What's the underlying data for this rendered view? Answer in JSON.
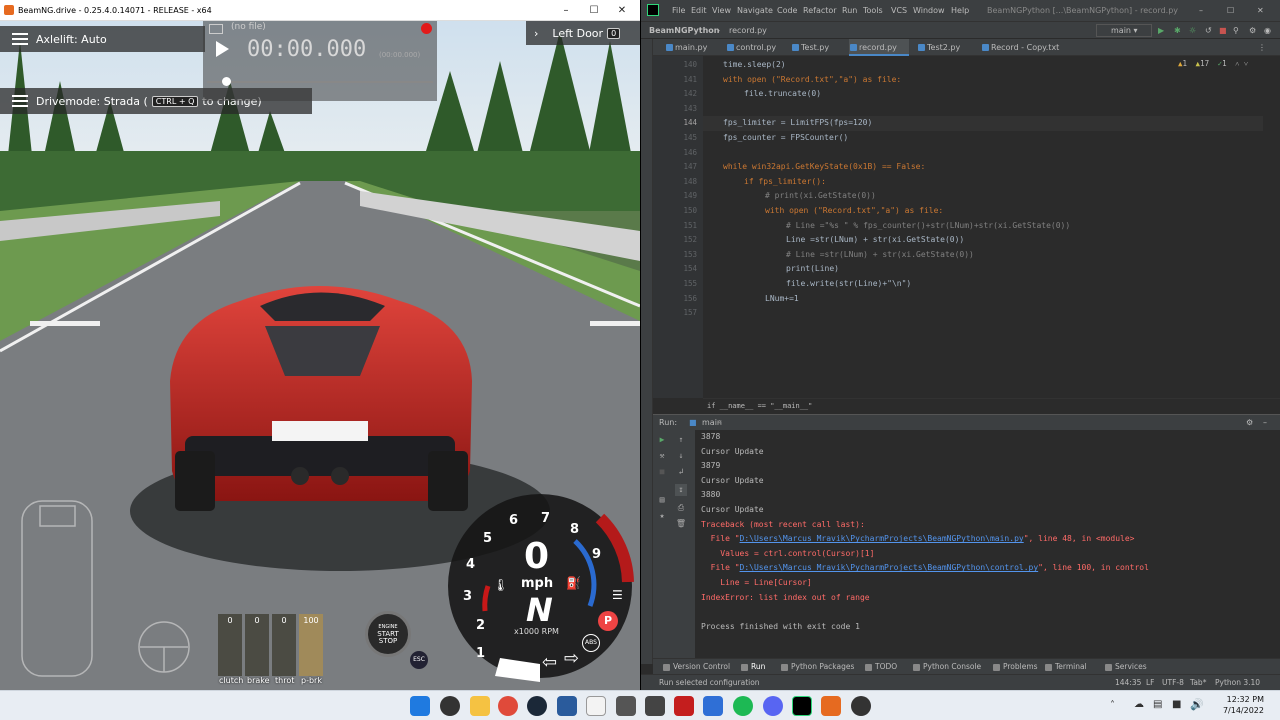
{
  "beamng": {
    "window_title": "BeamNG.drive - 0.25.4.0.14071 - RELEASE - x64",
    "hud": {
      "axlelift_label": "Axlelift: Auto",
      "drivemode_label": "Drivemode: Strada (",
      "drivemode_key": "CTRL + Q",
      "drivemode_suffix": "to change)",
      "file_label": "(no file)",
      "timer": "00:00.000",
      "timer_small": "(00:00.000)",
      "door_label": "Left Door",
      "door_key": "0"
    },
    "gauge": {
      "speed": "0",
      "speed_unit": "mph",
      "gear": "N",
      "rpm_unit": "x1000 RPM",
      "rpm_ticks": [
        "1",
        "2",
        "3",
        "4",
        "5",
        "6",
        "7",
        "8",
        "9"
      ],
      "park_label": "P",
      "abs_label": "ABS",
      "esc_label": "ESC"
    },
    "engine_button": {
      "line1": "ENGINE",
      "line2": "START",
      "line3": "STOP"
    },
    "pedals": [
      {
        "name": "clutch",
        "value": "0"
      },
      {
        "name": "brake",
        "value": "0"
      },
      {
        "name": "throt",
        "value": "0"
      },
      {
        "name": "p-brk",
        "value": "100"
      }
    ],
    "pedal_level_fraction": [
      0,
      0,
      0,
      1.0
    ]
  },
  "pycharm": {
    "menu": [
      "File",
      "Edit",
      "View",
      "Navigate",
      "Code",
      "Refactor",
      "Run",
      "Tools",
      "VCS",
      "Window",
      "Help"
    ],
    "window_title": "BeamNGPython [...\\BeamNGPython] - record.py",
    "project_name": "BeamNGPython",
    "current_file": "record.py",
    "branch": "main",
    "tabs": [
      "main.py",
      "control.py",
      "Test.py",
      "record.py",
      "Test2.py",
      "Record - Copy.txt"
    ],
    "active_tab": "record.py",
    "inspections": {
      "warnings": "1",
      "weak": "17",
      "typos": "1"
    },
    "code_lines": [
      {
        "n": "140",
        "t": "time.sleep(2)"
      },
      {
        "n": "141",
        "t": "with open (\"Record.txt\",\"a\") as file:"
      },
      {
        "n": "142",
        "t": "file.truncate(0)"
      },
      {
        "n": "143",
        "t": ""
      },
      {
        "n": "144",
        "t": "fps_limiter = LimitFPS(fps=120)"
      },
      {
        "n": "145",
        "t": "fps_counter = FPSCounter()"
      },
      {
        "n": "146",
        "t": ""
      },
      {
        "n": "147",
        "t": "while win32api.GetKeyState(0x1B) == False:"
      },
      {
        "n": "148",
        "t": "if fps_limiter():"
      },
      {
        "n": "149",
        "t": "# print(xi.GetState(0))"
      },
      {
        "n": "150",
        "t": "with open (\"Record.txt\",\"a\") as file:"
      },
      {
        "n": "151",
        "t": "# Line =\"%s \" % fps_counter()+str(LNum)+str(xi.GetState(0))"
      },
      {
        "n": "152",
        "t": "Line =str(LNum) + str(xi.GetState(0))"
      },
      {
        "n": "153",
        "t": "# Line =str(LNum) + str(xi.GetState(0))"
      },
      {
        "n": "154",
        "t": "print(Line)"
      },
      {
        "n": "155",
        "t": "file.write(str(Line)+\"\\n\")"
      },
      {
        "n": "156",
        "t": "LNum+=1"
      },
      {
        "n": "157",
        "t": ""
      }
    ],
    "breadcrumb": "if __name__ == \"__main__\"",
    "run_label": "Run:",
    "run_config": "main",
    "console_lines": [
      {
        "t": "3878",
        "k": "out"
      },
      {
        "t": "Cursor Update",
        "k": "out"
      },
      {
        "t": "3879",
        "k": "out"
      },
      {
        "t": "Cursor Update",
        "k": "out"
      },
      {
        "t": "3880",
        "k": "out"
      },
      {
        "t": "Cursor Update",
        "k": "out"
      },
      {
        "t": "Traceback (most recent call last):",
        "k": "err"
      },
      {
        "t": "  File \"",
        "link": "D:\\Users\\Marcus Mravik\\PycharmProjects\\BeamNGPython\\main.py",
        "rest": "\", line 48, in <module>",
        "k": "err"
      },
      {
        "t": "    Values = ctrl.control(Cursor)[1]",
        "k": "err"
      },
      {
        "t": "  File \"",
        "link": "D:\\Users\\Marcus Mravik\\PycharmProjects\\BeamNGPython\\control.py",
        "rest": "\", line 100, in control",
        "k": "err"
      },
      {
        "t": "    Line = Line[Cursor]",
        "k": "err"
      },
      {
        "t": "IndexError: list index out of range",
        "k": "err"
      },
      {
        "t": "",
        "k": "out"
      },
      {
        "t": "Process finished with exit code 1",
        "k": "out"
      }
    ],
    "bottom_tools": [
      "Version Control",
      "Run",
      "Python Packages",
      "TODO",
      "Python Console",
      "Problems",
      "Terminal",
      "Services"
    ],
    "status_left": "Run selected configuration",
    "status_right": [
      "144:35",
      "LF",
      "UTF-8",
      "Tab*",
      "Python 3.10"
    ]
  },
  "taskbar": {
    "time": "12:32 PM",
    "date": "7/14/2022",
    "icons": [
      "windows-start",
      "search",
      "file-explorer",
      "chrome",
      "steam",
      "remote-desktop",
      "notepad",
      "wifi-app",
      "acrobat",
      "cortana",
      "spotify",
      "discord",
      "pycharm",
      "beamng",
      "obs"
    ]
  }
}
